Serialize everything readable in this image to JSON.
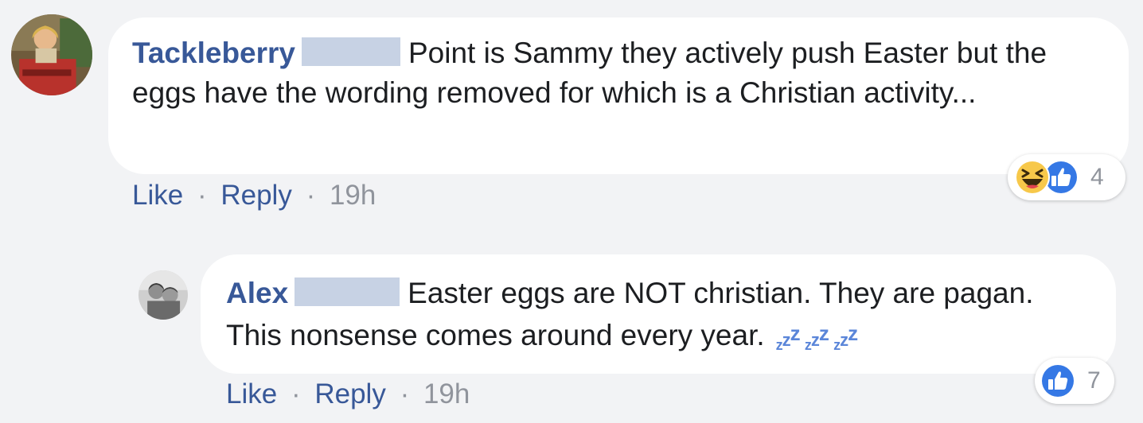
{
  "comments": [
    {
      "author": "Tackleberry",
      "text": "Point is Sammy they actively push Easter but the eggs have the wording removed for which is a Christian activity...",
      "actions": {
        "like": "Like",
        "separator": "·",
        "reply": "Reply",
        "time": "19h"
      },
      "reactions": {
        "icons": [
          "haha-icon",
          "like-icon"
        ],
        "count": "4"
      }
    },
    {
      "author": "Alex",
      "text": "Easter eggs are NOT christian. They are pagan. This nonsense comes around every year.",
      "emoji": {
        "name": "sleeping-zzz-icon",
        "glyphs": "zzz zzz zzz"
      },
      "actions": {
        "like": "Like",
        "separator": "·",
        "reply": "Reply",
        "time": "19h"
      },
      "reactions": {
        "icons": [
          "like-icon"
        ],
        "count": "7"
      }
    }
  ],
  "colors": {
    "background": "#f2f3f5",
    "bubble": "#ffffff",
    "author": "#385898",
    "link": "#385898",
    "meta": "#90949c",
    "redaction": "#c7d2e4",
    "like_blue": "#3578e5",
    "haha_yellow": "#f7c84a"
  }
}
